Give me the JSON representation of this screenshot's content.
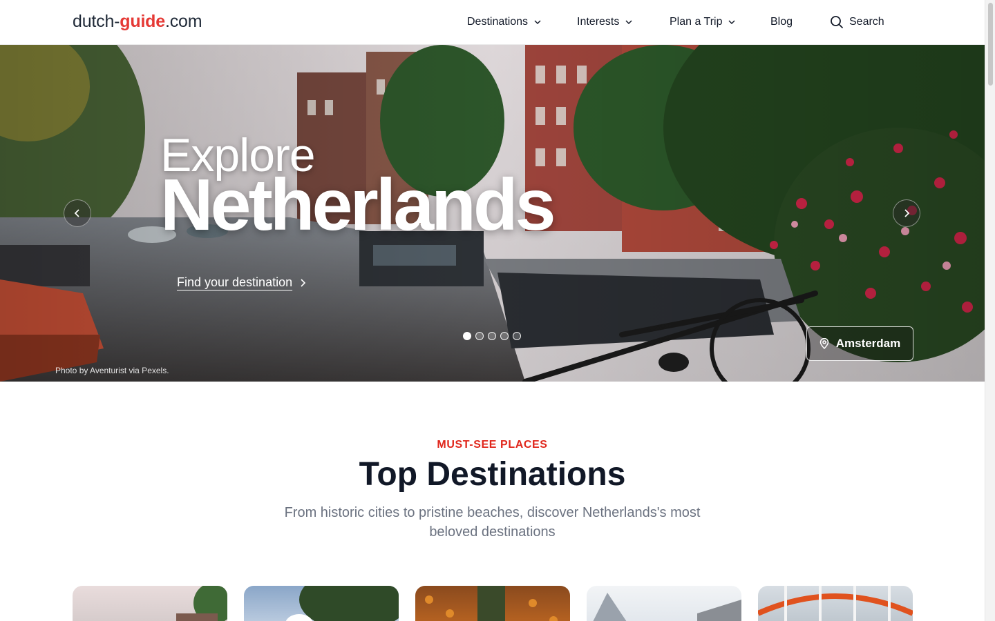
{
  "header": {
    "logo": {
      "prefix": "dutch-",
      "accent": "guide",
      "suffix": ".com"
    },
    "nav": [
      {
        "label": "Destinations",
        "has_dropdown": true
      },
      {
        "label": "Interests",
        "has_dropdown": true
      },
      {
        "label": "Plan a Trip",
        "has_dropdown": true
      },
      {
        "label": "Blog",
        "has_dropdown": false
      }
    ],
    "search_label": "Search"
  },
  "hero": {
    "kicker": "Explore",
    "title": "Netherlands",
    "cta_label": "Find your destination",
    "location": "Amsterdam",
    "photo_credit": "Photo by Aventurist via Pexels.",
    "slide_count": 5,
    "active_slide": 1
  },
  "section": {
    "kicker": "MUST-SEE PLACES",
    "title": "Top Destinations",
    "subtitle": "From historic cities to pristine beaches, discover Netherlands's most beloved destinations"
  },
  "colors": {
    "accent": "#e53935",
    "heading": "#111827",
    "muted": "#6b7280"
  }
}
